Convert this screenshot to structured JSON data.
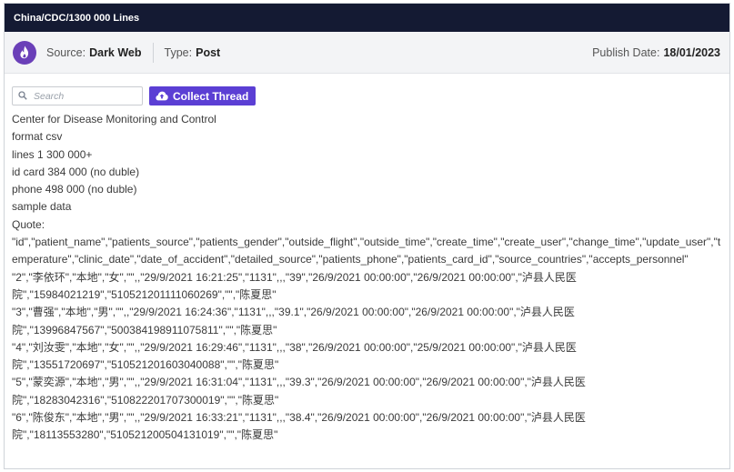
{
  "header": {
    "title": "China/CDC/1300 000 Lines"
  },
  "meta": {
    "source_label": "Source:",
    "source_value": "Dark Web",
    "type_label": "Type:",
    "type_value": "Post",
    "publish_label": "Publish Date:",
    "publish_value": "18/01/2023",
    "source_icon": "flame-icon",
    "accent_color": "#6a3fb8"
  },
  "toolbar": {
    "search_placeholder": "Search",
    "search_value": "",
    "collect_label": "Collect Thread",
    "collect_icon": "cloud-upload-icon",
    "button_color": "#5b3fd4"
  },
  "post": {
    "lines": [
      "Center for Disease Monitoring and Control",
      "format csv",
      "lines 1 300 000+",
      "id card 384 000 (no duble)",
      "phone 498 000 (no duble)",
      "sample data",
      "Quote:"
    ],
    "csv_header": "\"id\",\"patient_name\",\"patients_source\",\"patients_gender\",\"outside_flight\",\"outside_time\",\"create_time\",\"create_user\",\"change_time\",\"update_user\",\"temperature\",\"clinic_date\",\"date_of_accident\",\"detailed_source\",\"patients_phone\",\"patients_card_id\",\"source_countries\",\"accepts_personnel\"",
    "csv_rows": [
      [
        "\"2\",\"李依环\",\"本地\",\"女\",\"\",,\"29/9/2021 16:21:25\",\"1131\",,,\"39\",\"26/9/2021 00:00:00\",\"26/9/2021 00:00:00\",\"泸县人民医",
        "院\",\"15984021219\",\"510521201111060269\",\"\",\"陈夏思\""
      ],
      [
        "\"3\",\"曹强\",\"本地\",\"男\",\"\",,\"29/9/2021 16:24:36\",\"1131\",,,\"39.1\",\"26/9/2021 00:00:00\",\"26/9/2021 00:00:00\",\"泸县人民医",
        "院\",\"13996847567\",\"500384198911075811\",\"\",\"陈夏思\""
      ],
      [
        "\"4\",\"刘汝雯\",\"本地\",\"女\",\"\",,\"29/9/2021 16:29:46\",\"1131\",,,\"38\",\"26/9/2021 00:00:00\",\"25/9/2021 00:00:00\",\"泸县人民医",
        "院\",\"13551720697\",\"510521201603040088\",\"\",\"陈夏思\""
      ],
      [
        "\"5\",\"蒙奕源\",\"本地\",\"男\",\"\",,\"29/9/2021 16:31:04\",\"1131\",,,\"39.3\",\"26/9/2021 00:00:00\",\"26/9/2021 00:00:00\",\"泸县人民医",
        "院\",\"18283042316\",\"510822201707300019\",\"\",\"陈夏思\""
      ],
      [
        "\"6\",\"陈俊东\",\"本地\",\"男\",\"\",,\"29/9/2021 16:33:21\",\"1131\",,,\"38.4\",\"26/9/2021 00:00:00\",\"26/9/2021 00:00:00\",\"泸县人民医",
        "院\",\"18113553280\",\"510521200504131019\",\"\",\"陈夏思\""
      ]
    ]
  }
}
